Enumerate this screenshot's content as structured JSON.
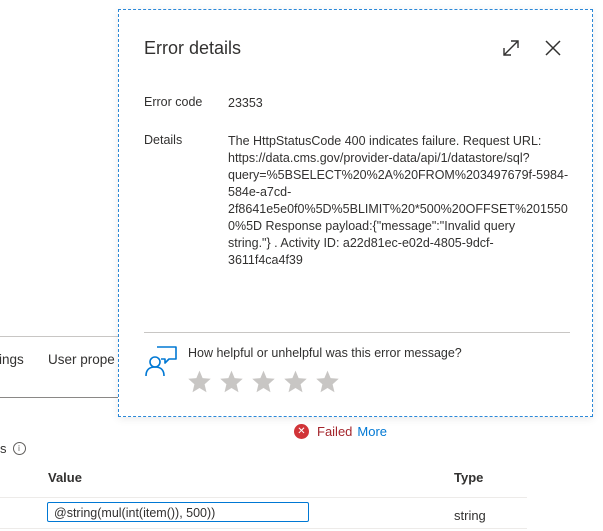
{
  "background": {
    "tabs": [
      "ings",
      "User prope"
    ],
    "params_label": "s",
    "status": {
      "text": "Failed",
      "link": "More",
      "color": "#d13438"
    },
    "table": {
      "headers": {
        "value": "Value",
        "type": "Type"
      },
      "row": {
        "value": "@string(mul(int(item()), 500))",
        "type": "string"
      }
    }
  },
  "dialog": {
    "title": "Error details",
    "icons": {
      "expand": "expand-icon",
      "close": "close-icon"
    },
    "error_code": {
      "label": "Error code",
      "value": "23353"
    },
    "details": {
      "label": "Details",
      "lines": [
        "The HttpStatusCode 400 indicates failure. Request URL:",
        "https://data.cms.gov/provider-data/api/1/datastore/sql?",
        "query=%5BSELECT%20%2A%20FROM%203497679f-5984-",
        "584e-a7cd-",
        "2f8641e5e0f0%5D%5BLIMIT%20*500%20OFFSET%201550",
        "0%5D Response payload:{\"message\":\"Invalid query",
        "string.\"} . Activity ID: a22d81ec-e02d-4805-9dcf-",
        "3611f4ca4f39"
      ]
    },
    "feedback": {
      "question": "How helpful or unhelpful was this error message?",
      "icon": "feedback-person-icon",
      "rating": 0,
      "max_rating": 5
    }
  },
  "colors": {
    "accent": "#0078d4",
    "error": "#d13438",
    "star": "#c8c6c4"
  }
}
